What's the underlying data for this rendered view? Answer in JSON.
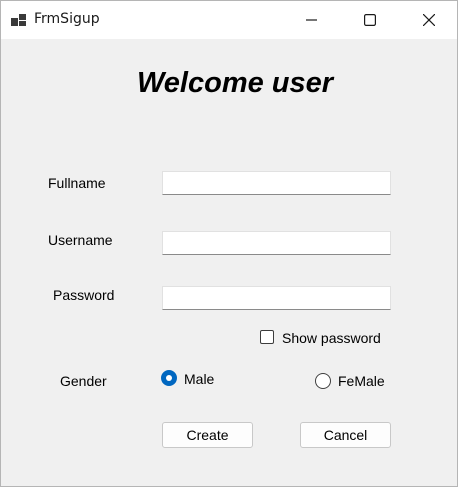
{
  "window": {
    "title": "FrmSigup"
  },
  "heading": "Welcome user",
  "form": {
    "fullname_label": "Fullname",
    "fullname_value": "",
    "username_label": "Username",
    "username_value": "",
    "password_label": "Password",
    "password_value": "",
    "show_password_label": "Show password",
    "show_password_checked": false,
    "gender_label": "Gender",
    "gender_options": [
      {
        "label": "Male",
        "selected": true
      },
      {
        "label": "FeMale",
        "selected": false
      }
    ]
  },
  "buttons": {
    "create": "Create",
    "cancel": "Cancel"
  },
  "colors": {
    "accent": "#0067c0",
    "background": "#f0f0f0",
    "titlebar": "#ffffff"
  }
}
